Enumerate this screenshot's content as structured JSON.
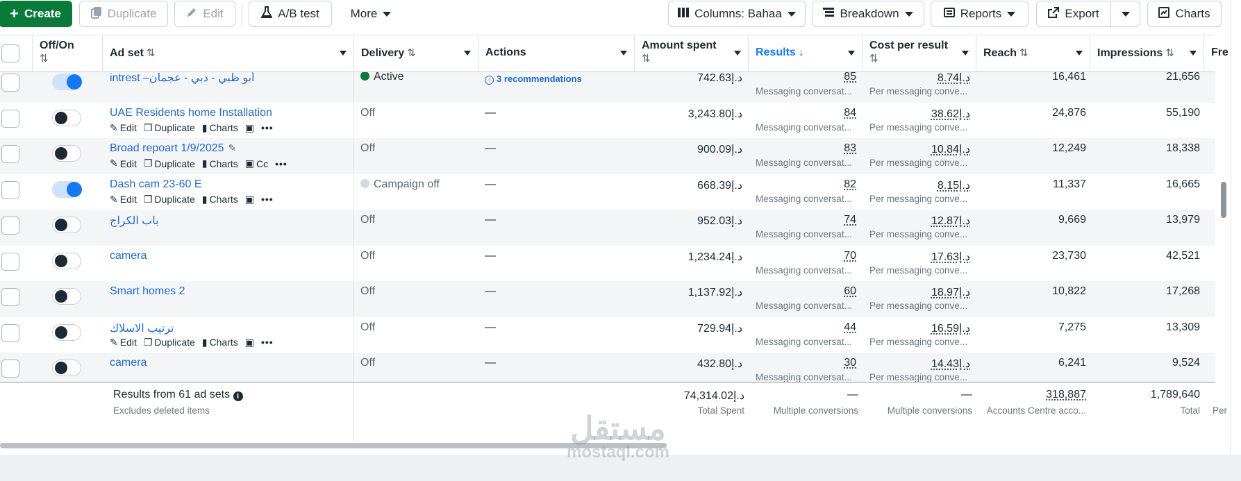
{
  "toolbar": {
    "create": "Create",
    "duplicate": "Duplicate",
    "edit": "Edit",
    "ab_test": "A/B test",
    "more": "More",
    "columns": "Columns: Bahaa",
    "breakdown": "Breakdown",
    "reports": "Reports",
    "export": "Export",
    "charts": "Charts"
  },
  "headers": {
    "off_on": "Off/On",
    "ad_set": "Ad set",
    "delivery": "Delivery",
    "actions": "Actions",
    "amount_spent": "Amount spent",
    "results": "Results",
    "cost_per_result": "Cost per result",
    "reach": "Reach",
    "impressions": "Impressions",
    "frequency": "Fre"
  },
  "row_actions": {
    "edit": "Edit",
    "duplicate": "Duplicate",
    "charts": "Charts",
    "compare": "Cc"
  },
  "rows": [
    {
      "name": "intrest –أبو ظبي - دبي - عجمان",
      "on": true,
      "delivery": "Active",
      "action": "3 recommendations",
      "spent": "742.63د.إ",
      "results": "85",
      "results_sub": "Messaging conversat...",
      "cpr": "8.74د.إ",
      "cpr_sub": "Per messaging conve...",
      "reach": "16,461",
      "impressions": "21,656"
    },
    {
      "name": "UAE Residents home Installation",
      "on": false,
      "delivery": "Off",
      "action": "—",
      "spent": "3,243.80د.إ",
      "results": "84",
      "results_sub": "Messaging conversat...",
      "cpr": "38.62د.إ",
      "cpr_sub": "Per messaging conve...",
      "reach": "24,876",
      "impressions": "55,190"
    },
    {
      "name": "Broad repoart 1/9/2025",
      "on": false,
      "delivery": "Off",
      "action": "—",
      "spent": "900.09د.إ",
      "results": "83",
      "results_sub": "Messaging conversat...",
      "cpr": "10.84د.إ",
      "cpr_sub": "Per messaging conve...",
      "reach": "12,249",
      "impressions": "18,338"
    },
    {
      "name": "Dash cam 23-60 E",
      "on": true,
      "delivery": "Campaign off",
      "action": "—",
      "spent": "668.39د.إ",
      "results": "82",
      "results_sub": "Messaging conversat...",
      "cpr": "8.15د.إ",
      "cpr_sub": "Per messaging conve...",
      "reach": "11,337",
      "impressions": "16,665"
    },
    {
      "name": "باب الكراج",
      "on": false,
      "delivery": "Off",
      "action": "—",
      "spent": "952.03د.إ",
      "results": "74",
      "results_sub": "Messaging conversat...",
      "cpr": "12.87د.إ",
      "cpr_sub": "Per messaging conve...",
      "reach": "9,669",
      "impressions": "13,979"
    },
    {
      "name": "camera",
      "on": false,
      "delivery": "Off",
      "action": "—",
      "spent": "1,234.24د.إ",
      "results": "70",
      "results_sub": "Messaging conversat...",
      "cpr": "17.63د.إ",
      "cpr_sub": "Per messaging conve...",
      "reach": "23,730",
      "impressions": "42,521"
    },
    {
      "name": "Smart homes 2",
      "on": false,
      "delivery": "Off",
      "action": "—",
      "spent": "1,137.92د.إ",
      "results": "60",
      "results_sub": "Messaging conversat...",
      "cpr": "18.97د.إ",
      "cpr_sub": "Per messaging conve...",
      "reach": "10,822",
      "impressions": "17,268"
    },
    {
      "name": "ترتيب الاسلاك",
      "on": false,
      "delivery": "Off",
      "action": "—",
      "spent": "729.94د.إ",
      "results": "44",
      "results_sub": "Messaging conversat...",
      "cpr": "16.59د.إ",
      "cpr_sub": "Per messaging conve...",
      "reach": "7,275",
      "impressions": "13,309"
    },
    {
      "name": "camera",
      "on": false,
      "delivery": "Off",
      "action": "—",
      "spent": "432.80د.إ",
      "results": "30",
      "results_sub": "Messaging conversat...",
      "cpr": "14.43د.إ",
      "cpr_sub": "Per messaging conve...",
      "reach": "6,241",
      "impressions": "9,524"
    }
  ],
  "footer": {
    "title": "Results from 61 ad sets",
    "subtitle": "Excludes deleted items",
    "spent": "74,314.02د.إ",
    "spent_sub": "Total Spent",
    "results": "—",
    "results_sub": "Multiple conversions",
    "cpr": "—",
    "cpr_sub": "Multiple conversions",
    "reach": "318,887",
    "reach_sub": "Accounts Centre acco...",
    "impressions": "1,789,640",
    "impressions_sub": "Total",
    "freq_sub": "Per"
  },
  "watermark": {
    "arabic": "مستقل",
    "latin": "mostaql.com"
  },
  "colors": {
    "create": "#0a7a3b",
    "link": "#1d6ac7",
    "toggle_on": "#1877f2",
    "active_dot": "#0a7a3b"
  }
}
